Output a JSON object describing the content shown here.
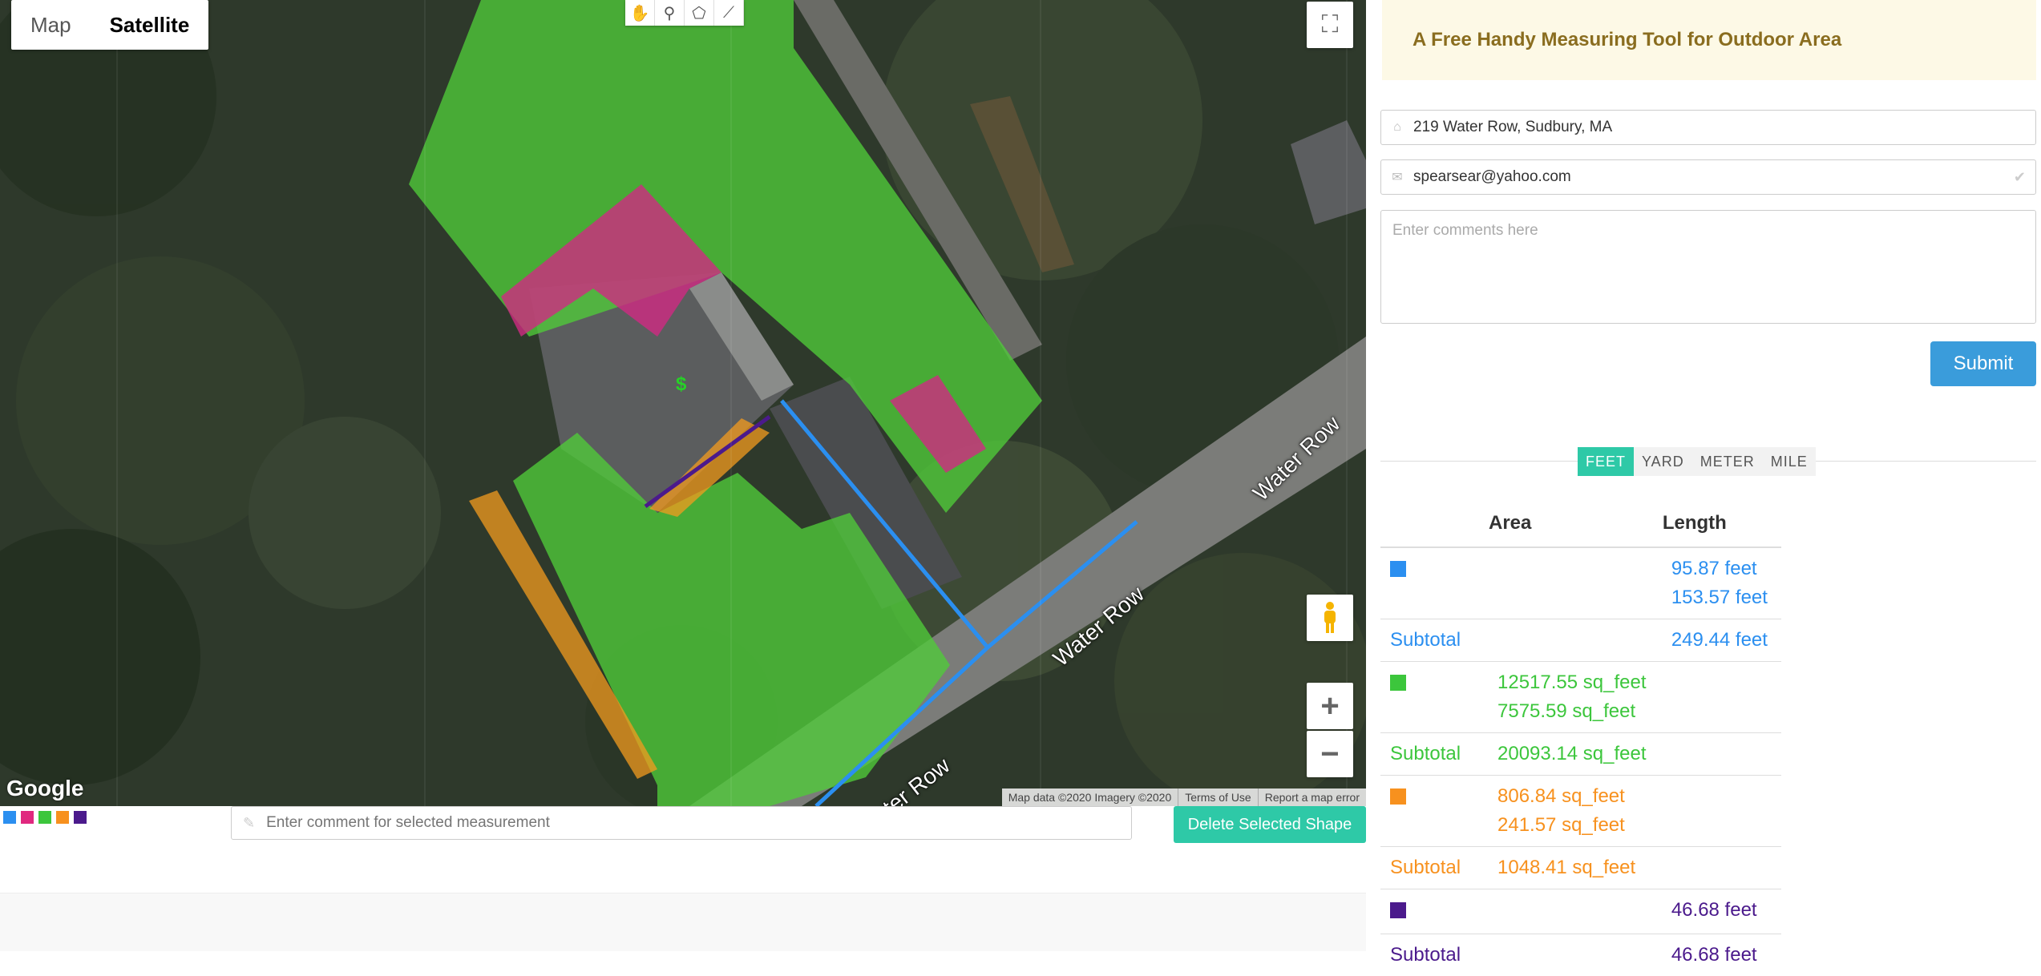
{
  "map": {
    "type_buttons": [
      "Map",
      "Satellite"
    ],
    "active_type": "Satellite",
    "road_labels": [
      "Water Row",
      "Water Row",
      "ater Row"
    ],
    "marker_symbol": "$",
    "logo": "Google",
    "attribution": [
      "Map data ©2020 Imagery ©2020",
      "Terms of Use",
      "Report a map error"
    ],
    "tools": [
      "hand-icon",
      "marker-icon",
      "polygon-icon",
      "polyline-icon"
    ]
  },
  "legend_colors": [
    "#2b8ff0",
    "#e0287f",
    "#3cc63c",
    "#f7911e",
    "#4b1a8c"
  ],
  "below_map": {
    "comment_placeholder": "Enter comment for selected measurement",
    "delete_label": "Delete Selected Shape"
  },
  "panel": {
    "banner": "A Free Handy Measuring Tool for Outdoor Area",
    "address": "219 Water Row, Sudbury, MA",
    "email": "spearsear@yahoo.com",
    "comments_placeholder": "Enter comments here",
    "submit_label": "Submit",
    "units": [
      "FEET",
      "YARD",
      "METER",
      "MILE"
    ],
    "active_unit": "FEET"
  },
  "results": {
    "headers": [
      "Area",
      "Length"
    ],
    "groups": [
      {
        "color": "#2b8ff0",
        "areas": [],
        "lengths": [
          "95.87 feet",
          "153.57 feet"
        ],
        "subtotal_label": "Subtotal",
        "subtotal_area": "",
        "subtotal_length": "249.44 feet"
      },
      {
        "color": "#3cc63c",
        "areas": [
          "12517.55 sq_feet",
          "7575.59 sq_feet"
        ],
        "lengths": [],
        "subtotal_label": "Subtotal",
        "subtotal_area": "20093.14 sq_feet",
        "subtotal_length": ""
      },
      {
        "color": "#f7911e",
        "areas": [
          "806.84 sq_feet",
          "241.57 sq_feet"
        ],
        "lengths": [],
        "subtotal_label": "Subtotal",
        "subtotal_area": "1048.41 sq_feet",
        "subtotal_length": ""
      },
      {
        "color": "#4b1a8c",
        "areas": [],
        "lengths": [
          "46.68 feet"
        ],
        "subtotal_label": "Subtotal",
        "subtotal_area": "",
        "subtotal_length": "46.68 feet"
      }
    ]
  }
}
